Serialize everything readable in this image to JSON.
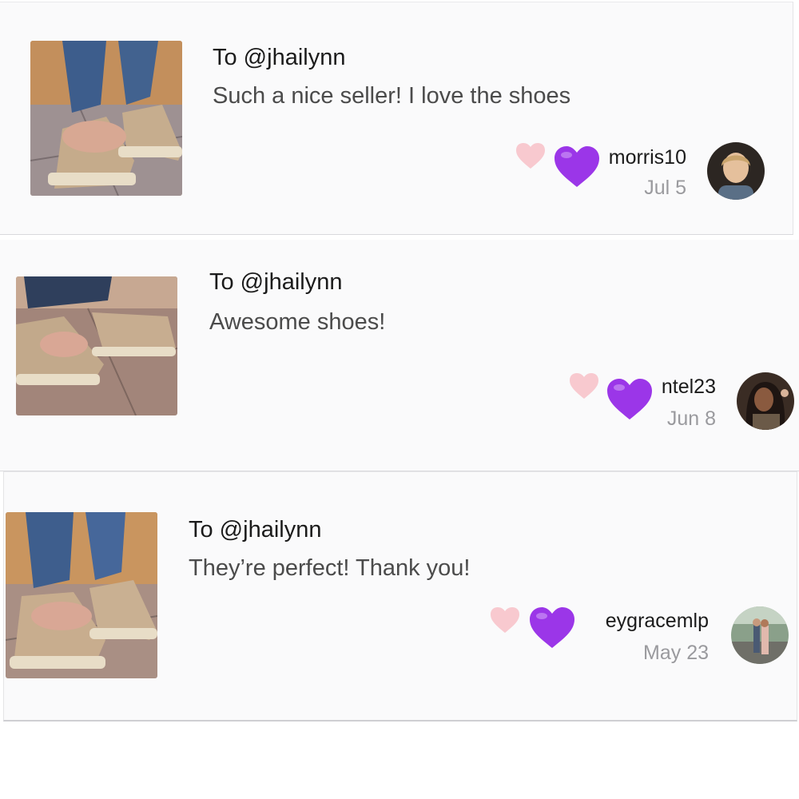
{
  "reviews": [
    {
      "to": "To @jhailynn",
      "message": "Such a nice seller! I love the shoes",
      "username": "morris10",
      "date": "Jul 5",
      "like_icon": "pink-heart-icon",
      "emoji": "purple-heart-emoji"
    },
    {
      "to": "To @jhailynn",
      "message": "Awesome shoes!",
      "username": "ntel23",
      "date": "Jun 8",
      "like_icon": "pink-heart-icon",
      "emoji": "purple-heart-emoji"
    },
    {
      "to": "To @jhailynn",
      "message": "They’re perfect! Thank you!",
      "username": "eygracemlp",
      "date": "May 23",
      "like_icon": "pink-heart-icon",
      "emoji": "purple-heart-emoji"
    }
  ],
  "colors": {
    "card_bg": "#fafafb",
    "pink_heart": "#f8c9cf",
    "purple_heart": "#9b36e8",
    "date_text": "#9a9a9e"
  }
}
